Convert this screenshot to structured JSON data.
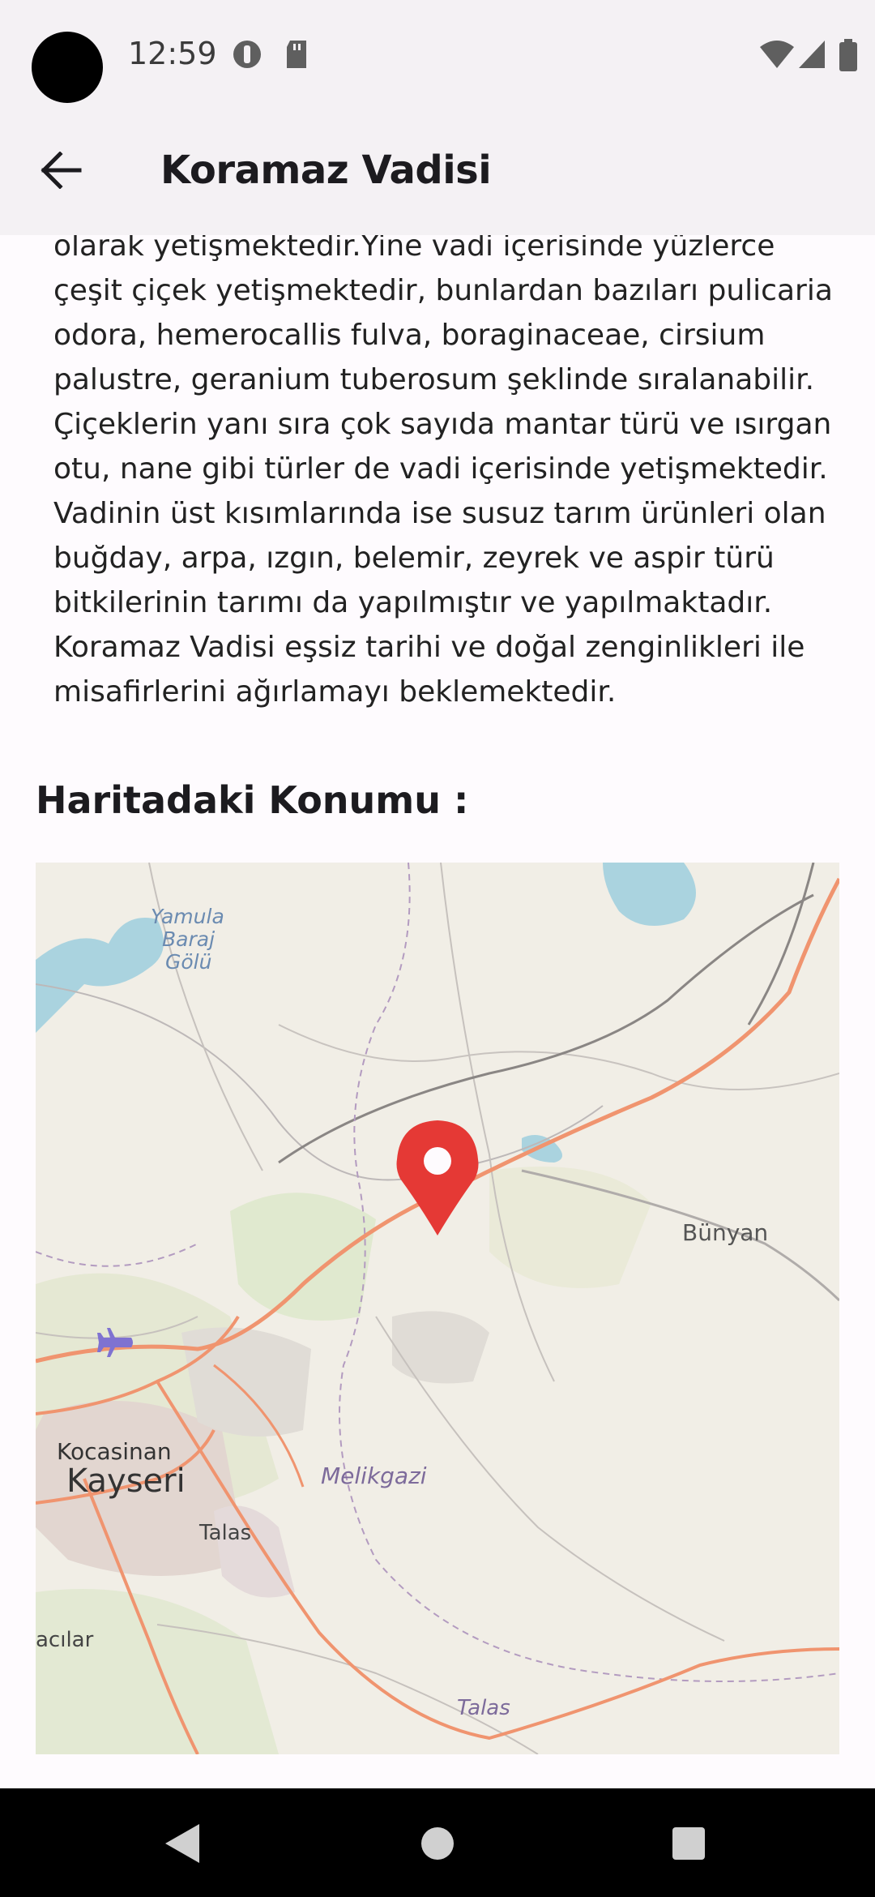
{
  "status_bar": {
    "time": "12:59"
  },
  "app_bar": {
    "title": "Koramaz Vadisi"
  },
  "content": {
    "description": "olarak yetişmektedir.Yine vadi içerisinde yüzlerce çeşit çiçek yetişmektedir, bunlardan bazıları pulicaria odora, hemerocallis fulva, boraginaceae, cirsium palustre, geranium tuberosum şeklinde sıralanabilir. Çiçeklerin yanı sıra çok sayıda mantar türü ve ısırgan otu, nane gibi türler de vadi içerisinde yetişmektedir. Vadinin üst kısımlarında ise susuz tarım ürünleri olan buğday, arpa, ızgın, belemir, zeyrek ve aspir türü bitkilerinin tarımı da yapılmıştır ve yapılmaktadır. Koramaz Vadisi eşsiz tarihi ve doğal zenginlikleri ile misafirlerini ağırlamayı beklemektedir.",
    "map_section_title": "Haritadaki Konumu :"
  },
  "map": {
    "labels": {
      "yamula_1": "Yamula",
      "yamula_2": "Baraj",
      "yamula_3": "Gölü",
      "bunyan": "Bünyan",
      "kocasinan": "Kocasinan",
      "kayseri": "Kayseri",
      "melikgazi": "Melikgazi",
      "talas": "Talas",
      "talas_district": "Talas",
      "hacilar": "acılar"
    },
    "marker_color": "#e53935",
    "road_color": "#f0946f",
    "water_color": "#aad3df"
  }
}
